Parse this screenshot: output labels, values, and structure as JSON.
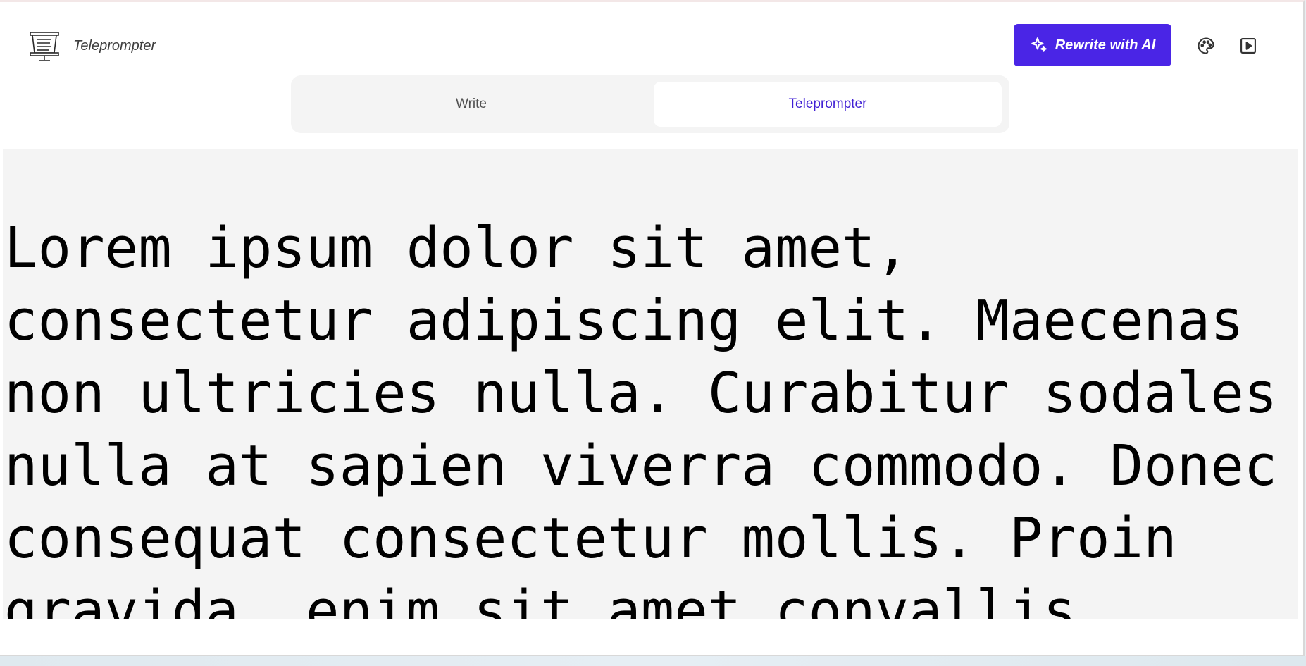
{
  "header": {
    "app_title": "Teleprompter",
    "logo_icon": "teleprompter-icon",
    "rewrite_button_label": "Rewrite with AI",
    "rewrite_icon": "sparkles-icon",
    "theme_icon": "palette-icon",
    "play_icon": "play-icon"
  },
  "tabs": [
    {
      "label": "Write",
      "active": false
    },
    {
      "label": "Teleprompter",
      "active": true
    }
  ],
  "prompter": {
    "text": "Lorem ipsum dolor sit amet, consectetur adipiscing elit. Maecenas non ultricies nulla. Curabitur sodales nulla at sapien viverra commodo. Donec consequat consectetur mollis. Proin gravida, enim sit amet convallis"
  },
  "colors": {
    "accent": "#4a25e6",
    "active_tab_text": "#3f1fd4",
    "prompter_background": "#f4f4f4"
  }
}
